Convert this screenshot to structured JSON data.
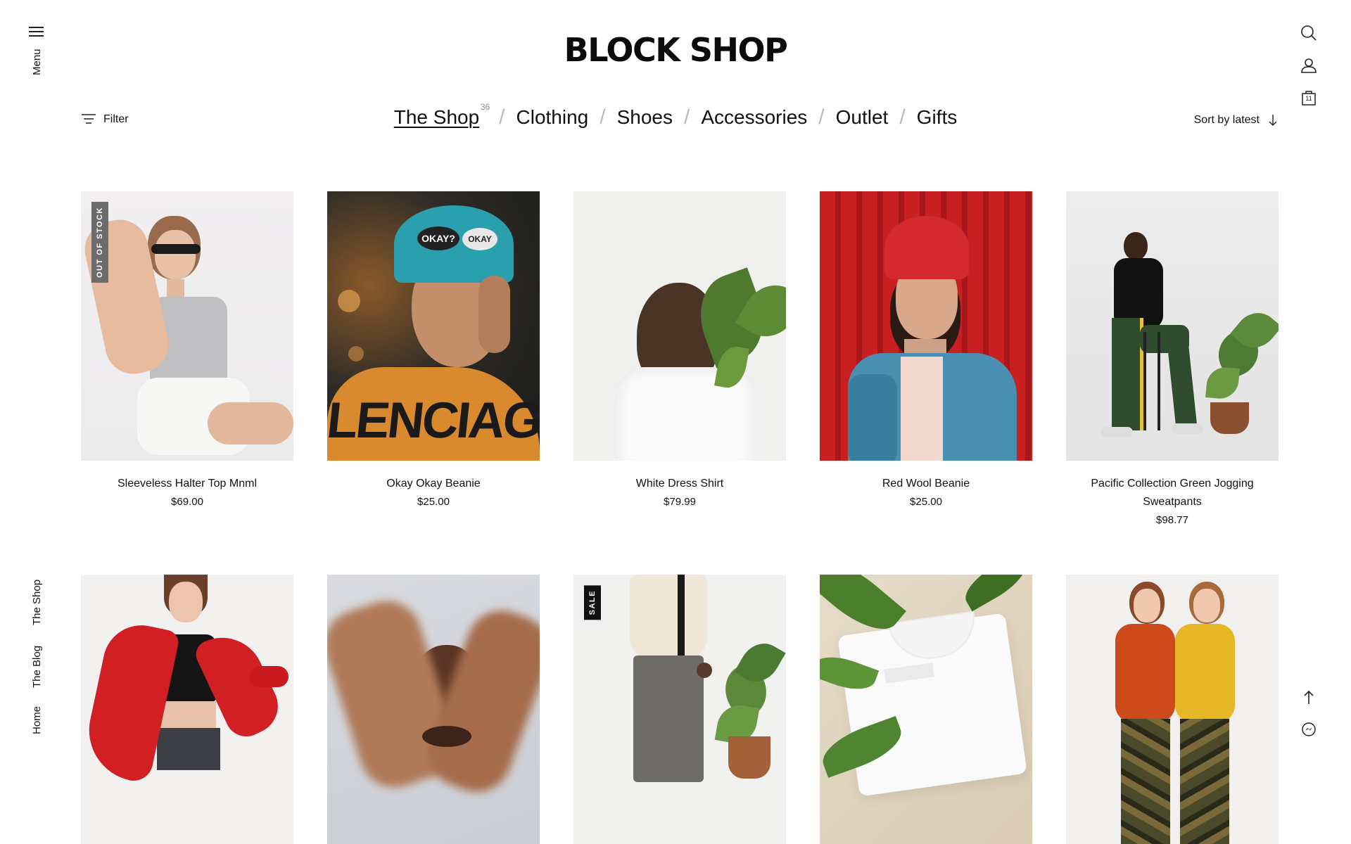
{
  "header": {
    "logo": "BLOCK SHOP",
    "menu_label": "Menu",
    "filter_label": "Filter",
    "sort_label": "Sort by latest"
  },
  "categories": [
    {
      "label": "The Shop",
      "count": "36",
      "active": true
    },
    {
      "label": "Clothing"
    },
    {
      "label": "Shoes"
    },
    {
      "label": "Accessories"
    },
    {
      "label": "Outlet"
    },
    {
      "label": "Gifts"
    }
  ],
  "side_nav": [
    "The Shop",
    "The Blog",
    "Home"
  ],
  "right_icons": [
    "search-icon",
    "account-icon",
    "cart-icon",
    "arrow-up-icon",
    "messenger-icon"
  ],
  "cart_count": "11",
  "products": [
    {
      "name": "Sleeveless Halter Top Mnml",
      "price": "$69.00",
      "badge": "OUT OF STOCK"
    },
    {
      "name": "Okay Okay Beanie",
      "price": "$25.00"
    },
    {
      "name": "White Dress Shirt",
      "price": "$79.99"
    },
    {
      "name": "Red Wool Beanie",
      "price": "$25.00"
    },
    {
      "name": "Pacific Collection Green Jogging Sweatpants",
      "price": "$98.77"
    },
    {
      "name": "",
      "price": ""
    },
    {
      "name": "",
      "price": ""
    },
    {
      "name": "",
      "price": "",
      "badge": "SALE"
    },
    {
      "name": "",
      "price": ""
    },
    {
      "name": "",
      "price": ""
    }
  ],
  "beanie_text": [
    "OKAY?",
    "OKAY"
  ],
  "sweater_text": "LENCIAGA",
  "colors": {
    "text": "#111111",
    "badge": "#111111",
    "badge_out_of_stock": "#6b6b6b",
    "background": "#ffffff"
  }
}
